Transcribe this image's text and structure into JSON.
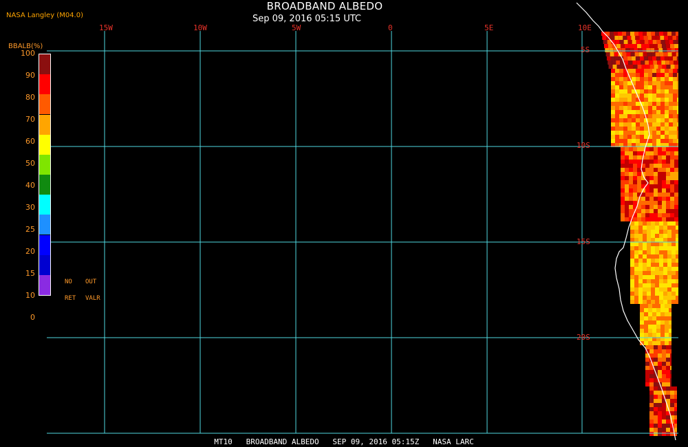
{
  "header": {
    "title": "BROADBAND ALBEDO",
    "subtitle": "Sep 09, 2016 05:15 UTC",
    "source": "NASA Langley (M04.0)"
  },
  "map": {
    "longitude_labels": [
      "15W",
      "10W",
      "5W",
      "0",
      "5E",
      "10E"
    ],
    "latitude_labels": [
      "5S",
      "10S",
      "15S",
      "20S"
    ],
    "grid_color": "#4fd8e0",
    "label_color": "#e8332a",
    "coastline_color": "#ffffff",
    "background": "#000000"
  },
  "colorbar": {
    "title": "BBALB(%)",
    "ticks": [
      "100",
      "90",
      "80",
      "70",
      "60",
      "50",
      "40",
      "30",
      "25",
      "20",
      "15",
      "10",
      "0"
    ],
    "colors": [
      "#8b0f0f",
      "#ff0000",
      "#ff5a00",
      "#ffa500",
      "#ffff00",
      "#7fe500",
      "#108a10",
      "#00ffff",
      "#1e90ff",
      "#0000ff",
      "#0000d0",
      "#8a2be2"
    ],
    "no_retrieval_label": [
      "NO",
      "RET"
    ],
    "out_of_range_label": [
      "OUT",
      "VALR"
    ]
  },
  "footer": {
    "text": "MT10   BROADBAND ALBEDO   SEP 09, 2016 05:15Z   NASA LARC"
  }
}
